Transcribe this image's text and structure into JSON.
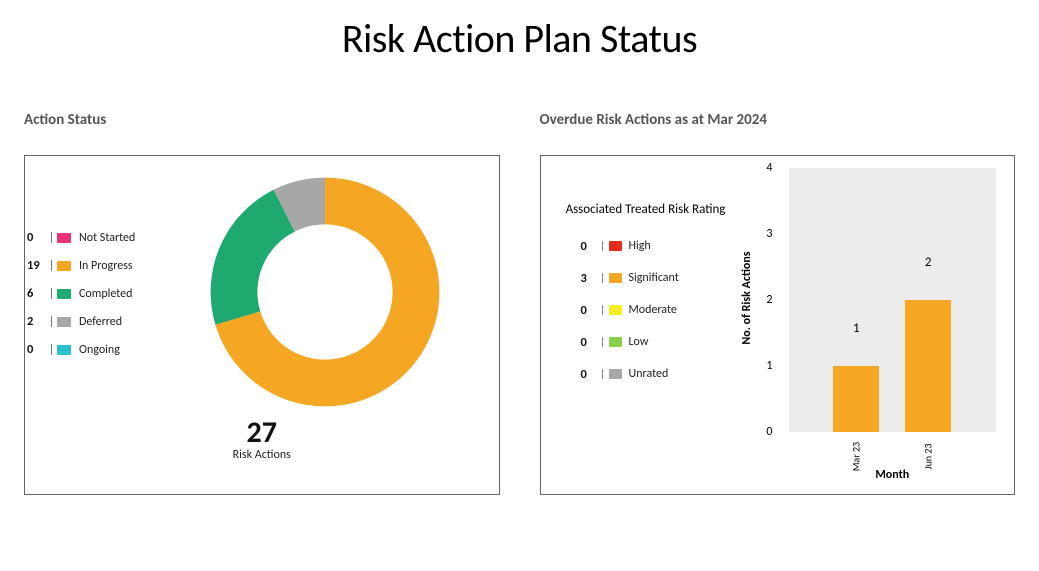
{
  "page_title": "Risk Action Plan Status",
  "left": {
    "title": "Action Status",
    "total_label": "Risk Actions",
    "total": 27,
    "legend": [
      {
        "label": "Not Started",
        "count": 0,
        "color": "#e63475"
      },
      {
        "label": "In Progress",
        "count": 19,
        "color": "#f5a623"
      },
      {
        "label": "Completed",
        "count": 6,
        "color": "#1eaa6e"
      },
      {
        "label": "Deferred",
        "count": 2,
        "color": "#a7a7a7"
      },
      {
        "label": "Ongoing",
        "count": 0,
        "color": "#2bc0cf"
      }
    ]
  },
  "right": {
    "title": "Overdue Risk Actions as at Mar 2024",
    "legend_title": "Associated Treated Risk Rating",
    "legend": [
      {
        "label": "High",
        "count": 0,
        "color": "#e52d1d"
      },
      {
        "label": "Significant",
        "count": 3,
        "color": "#f5a623"
      },
      {
        "label": "Moderate",
        "count": 0,
        "color": "#f4ed21"
      },
      {
        "label": "Low",
        "count": 0,
        "color": "#89cf4a"
      },
      {
        "label": "Unrated",
        "count": 0,
        "color": "#a7a7a7"
      }
    ],
    "ylabel": "No. of Risk Actions",
    "xlabel": "Month"
  },
  "chart_data": [
    {
      "type": "pie",
      "title": "Action Status",
      "categories": [
        "Not Started",
        "In Progress",
        "Completed",
        "Deferred",
        "Ongoing"
      ],
      "values": [
        0,
        19,
        6,
        2,
        0
      ],
      "colors": [
        "#e63475",
        "#f5a623",
        "#1eaa6e",
        "#a7a7a7",
        "#2bc0cf"
      ],
      "total": 27,
      "donut": true
    },
    {
      "type": "bar",
      "title": "Overdue Risk Actions as at Mar 2024",
      "categories": [
        "Mar 23",
        "Jun 23"
      ],
      "values": [
        1,
        2
      ],
      "xlabel": "Month",
      "ylabel": "No. of Risk Actions",
      "ylim": [
        0,
        4
      ],
      "series_name": "Significant",
      "color": "#f5a623"
    }
  ]
}
